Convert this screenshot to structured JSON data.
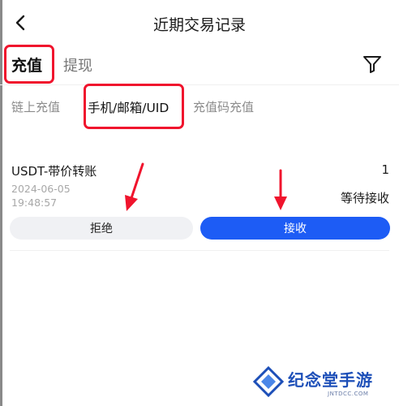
{
  "header": {
    "title": "近期交易记录"
  },
  "tabs": {
    "recharge": "充值",
    "withdraw": "提现"
  },
  "sub_tabs": {
    "chain": "链上充值",
    "phone": "手机/邮箱/UID",
    "code": "充值码充值"
  },
  "record": {
    "title": "USDT-带价转账",
    "amount": "1",
    "date": "2024-06-05",
    "time": "19:48:57",
    "status": "等待接收",
    "reject_label": "拒绝",
    "accept_label": "接收"
  },
  "watermark": {
    "text": "纪念堂手游",
    "sub": "JNTDCC.COM"
  },
  "colors": {
    "accent": "#1d5cf5",
    "highlight": "#f0142d",
    "brand": "#1d4fb8"
  },
  "icons": {
    "back": "chevron-left-icon",
    "filter": "filter-icon",
    "arrow": "red-arrow-down-icon"
  }
}
